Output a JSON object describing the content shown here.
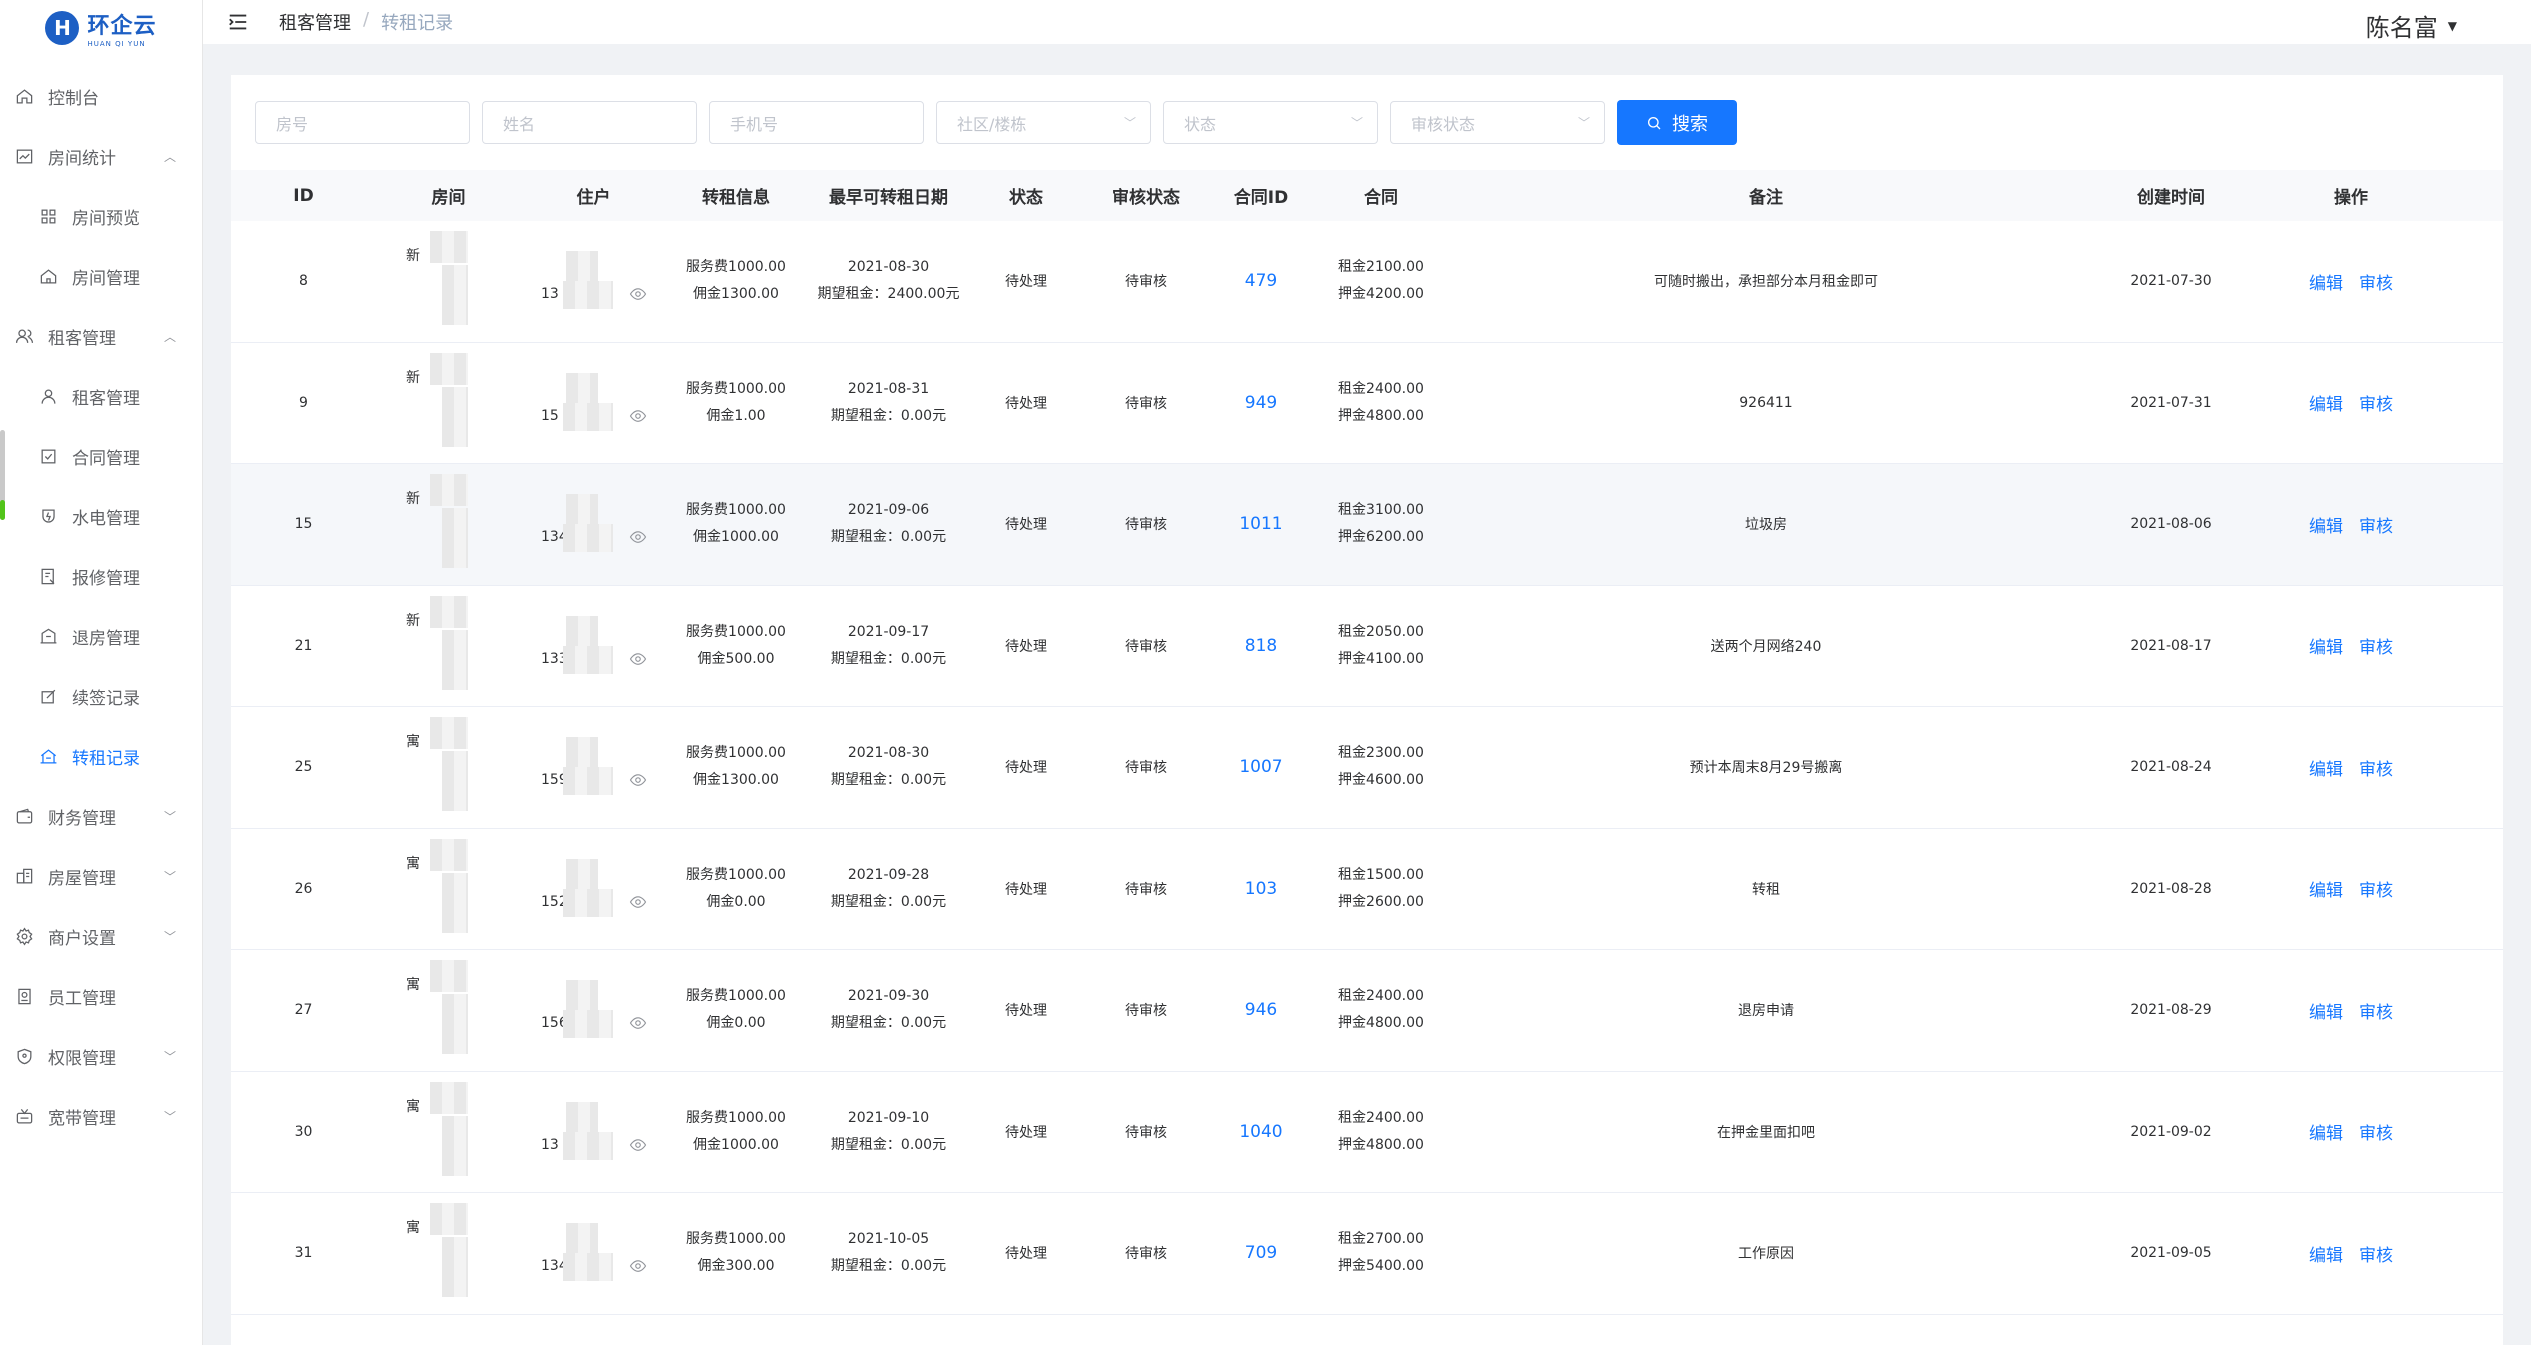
{
  "sidebar": {
    "logo_name": "环企云",
    "logo_sub": "HUAN QI YUN",
    "items": [
      {
        "label": "控制台",
        "icon": "home-icon",
        "sub": false,
        "chevron": ""
      },
      {
        "label": "房间统计",
        "icon": "chart-icon",
        "sub": false,
        "chevron": "^"
      },
      {
        "label": "房间预览",
        "icon": "grid-icon",
        "sub": true,
        "chevron": ""
      },
      {
        "label": "房间管理",
        "icon": "house-icon",
        "sub": true,
        "chevron": ""
      },
      {
        "label": "租客管理",
        "icon": "users-icon",
        "sub": false,
        "chevron": "^"
      },
      {
        "label": "租客管理",
        "icon": "user-icon",
        "sub": true,
        "chevron": ""
      },
      {
        "label": "合同管理",
        "icon": "check-square-icon",
        "sub": true,
        "chevron": ""
      },
      {
        "label": "水电管理",
        "icon": "bolt-icon",
        "sub": true,
        "chevron": ""
      },
      {
        "label": "报修管理",
        "icon": "repair-icon",
        "sub": true,
        "chevron": ""
      },
      {
        "label": "退房管理",
        "icon": "door-icon",
        "sub": true,
        "chevron": ""
      },
      {
        "label": "续签记录",
        "icon": "edit-icon",
        "sub": true,
        "chevron": ""
      },
      {
        "label": "转租记录",
        "icon": "building-icon",
        "sub": true,
        "chevron": "",
        "active": true
      },
      {
        "label": "财务管理",
        "icon": "wallet-icon",
        "sub": false,
        "chevron": "v"
      },
      {
        "label": "房屋管理",
        "icon": "buildings-icon",
        "sub": false,
        "chevron": "v"
      },
      {
        "label": "商户设置",
        "icon": "gear-icon",
        "sub": false,
        "chevron": "v"
      },
      {
        "label": "员工管理",
        "icon": "badge-icon",
        "sub": false,
        "chevron": ""
      },
      {
        "label": "权限管理",
        "icon": "shield-icon",
        "sub": false,
        "chevron": "v"
      },
      {
        "label": "宽带管理",
        "icon": "tv-icon",
        "sub": false,
        "chevron": "v"
      }
    ]
  },
  "header": {
    "breadcrumb_parent": "租客管理",
    "breadcrumb_sep": "/",
    "breadcrumb_current": "转租记录",
    "user_name": "陈名富"
  },
  "filters": {
    "room_placeholder": "房号",
    "name_placeholder": "姓名",
    "phone_placeholder": "手机号",
    "community_placeholder": "社区/楼栋",
    "status_placeholder": "状态",
    "audit_placeholder": "审核状态",
    "search_label": "搜索"
  },
  "table": {
    "headers": [
      "ID",
      "房间",
      "住户",
      "转租信息",
      "最早可转租日期",
      "状态",
      "审核状态",
      "合同ID",
      "合同",
      "备注",
      "创建时间",
      "操作"
    ],
    "edit_label": "编辑",
    "audit_label": "审核",
    "rows": [
      {
        "id": "8",
        "room": "新",
        "phone": "13",
        "fee": "服务费1000.00",
        "commission": "佣金1300.00",
        "date": "2021-08-30",
        "expect": "期望租金：2400.00元",
        "state": "待处理",
        "audit": "待审核",
        "cid": "479",
        "rent": "租金2100.00",
        "deposit": "押金4200.00",
        "remark": "可随时搬出，承担部分本月租金即可",
        "created": "2021-07-30"
      },
      {
        "id": "9",
        "room": "新",
        "phone": "15",
        "fee": "服务费1000.00",
        "commission": "佣金1.00",
        "date": "2021-08-31",
        "expect": "期望租金：0.00元",
        "state": "待处理",
        "audit": "待审核",
        "cid": "949",
        "rent": "租金2400.00",
        "deposit": "押金4800.00",
        "remark": "926411",
        "created": "2021-07-31"
      },
      {
        "id": "15",
        "room": "新",
        "phone": "134",
        "fee": "服务费1000.00",
        "commission": "佣金1000.00",
        "date": "2021-09-06",
        "expect": "期望租金：0.00元",
        "state": "待处理",
        "audit": "待审核",
        "cid": "1011",
        "rent": "租金3100.00",
        "deposit": "押金6200.00",
        "remark": "垃圾房",
        "created": "2021-08-06"
      },
      {
        "id": "21",
        "room": "新",
        "phone": "1333",
        "fee": "服务费1000.00",
        "commission": "佣金500.00",
        "date": "2021-09-17",
        "expect": "期望租金：0.00元",
        "state": "待处理",
        "audit": "待审核",
        "cid": "818",
        "rent": "租金2050.00",
        "deposit": "押金4100.00",
        "remark": "送两个月网络240",
        "created": "2021-08-17"
      },
      {
        "id": "25",
        "room": "寓",
        "phone": "15949",
        "fee": "服务费1000.00",
        "commission": "佣金1300.00",
        "date": "2021-08-30",
        "expect": "期望租金：0.00元",
        "state": "待处理",
        "audit": "待审核",
        "cid": "1007",
        "rent": "租金2300.00",
        "deposit": "押金4600.00",
        "remark": "预计本周末8月29号搬离",
        "created": "2021-08-24"
      },
      {
        "id": "26",
        "room": "寓",
        "phone": "1522",
        "fee": "服务费1000.00",
        "commission": "佣金0.00",
        "date": "2021-09-28",
        "expect": "期望租金：0.00元",
        "state": "待处理",
        "audit": "待审核",
        "cid": "103",
        "rent": "租金1500.00",
        "deposit": "押金2600.00",
        "remark": "转租",
        "created": "2021-08-28"
      },
      {
        "id": "27",
        "room": "寓",
        "phone": "156",
        "fee": "服务费1000.00",
        "commission": "佣金0.00",
        "date": "2021-09-30",
        "expect": "期望租金：0.00元",
        "state": "待处理",
        "audit": "待审核",
        "cid": "946",
        "rent": "租金2400.00",
        "deposit": "押金4800.00",
        "remark": "退房申请",
        "created": "2021-08-29"
      },
      {
        "id": "30",
        "room": "寓",
        "phone": "13",
        "fee": "服务费1000.00",
        "commission": "佣金1000.00",
        "date": "2021-09-10",
        "expect": "期望租金：0.00元",
        "state": "待处理",
        "audit": "待审核",
        "cid": "1040",
        "rent": "租金2400.00",
        "deposit": "押金4800.00",
        "remark": "在押金里面扣吧",
        "created": "2021-09-02"
      },
      {
        "id": "31",
        "room": "寓",
        "phone": "134",
        "fee": "服务费1000.00",
        "commission": "佣金300.00",
        "date": "2021-10-05",
        "expect": "期望租金：0.00元",
        "state": "待处理",
        "audit": "待审核",
        "cid": "709",
        "rent": "租金2700.00",
        "deposit": "押金5400.00",
        "remark": "工作原因",
        "created": "2021-09-05"
      }
    ]
  }
}
